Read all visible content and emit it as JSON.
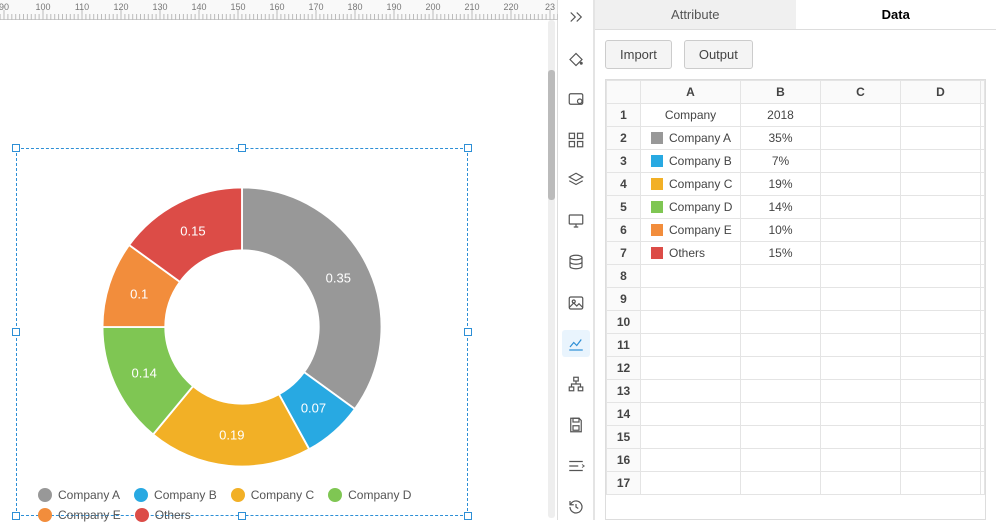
{
  "ruler_ticks": [
    90,
    100,
    110,
    120,
    130,
    140,
    150,
    160,
    170,
    180,
    190,
    200,
    210,
    220,
    "23"
  ],
  "panel": {
    "tabs": {
      "attribute": "Attribute",
      "data": "Data"
    },
    "buttons": {
      "import": "Import",
      "output": "Output"
    },
    "columns": [
      "A",
      "B",
      "C",
      "D"
    ],
    "header_row": {
      "a": "Company",
      "b": "2018"
    },
    "rows": [
      {
        "n": 1
      },
      {
        "n": 2,
        "a": "Company A",
        "b": "35%"
      },
      {
        "n": 3,
        "a": "Company B",
        "b": "7%"
      },
      {
        "n": 4,
        "a": "Company C",
        "b": "19%"
      },
      {
        "n": 5,
        "a": "Company D",
        "b": "14%"
      },
      {
        "n": 6,
        "a": "Company E",
        "b": "10%"
      },
      {
        "n": 7,
        "a": "Others",
        "b": "15%"
      }
    ],
    "blank_rows": [
      8,
      9,
      10,
      11,
      12,
      13,
      14,
      15,
      16,
      17
    ]
  },
  "legend": [
    {
      "label": "Company A"
    },
    {
      "label": "Company B"
    },
    {
      "label": "Company C"
    },
    {
      "label": "Company D"
    },
    {
      "label": "Company E"
    },
    {
      "label": "Others"
    }
  ],
  "colors": {
    "Company A": "#989898",
    "Company B": "#28a9e2",
    "Company C": "#f2b026",
    "Company D": "#7fc653",
    "Company E": "#f28d3c",
    "Others": "#dc4c47"
  },
  "chart_labels": [
    "0.35",
    "0.07",
    "0.19",
    "0.14",
    "0.1",
    "0.15"
  ],
  "chart_data": {
    "type": "pie",
    "title": "",
    "categories": [
      "Company A",
      "Company B",
      "Company C",
      "Company D",
      "Company E",
      "Others"
    ],
    "values": [
      0.35,
      0.07,
      0.19,
      0.14,
      0.1,
      0.15
    ],
    "colors": [
      "#989898",
      "#28a9e2",
      "#f2b026",
      "#7fc653",
      "#f28d3c",
      "#dc4c47"
    ],
    "donut_inner_radius_ratio": 0.55
  }
}
